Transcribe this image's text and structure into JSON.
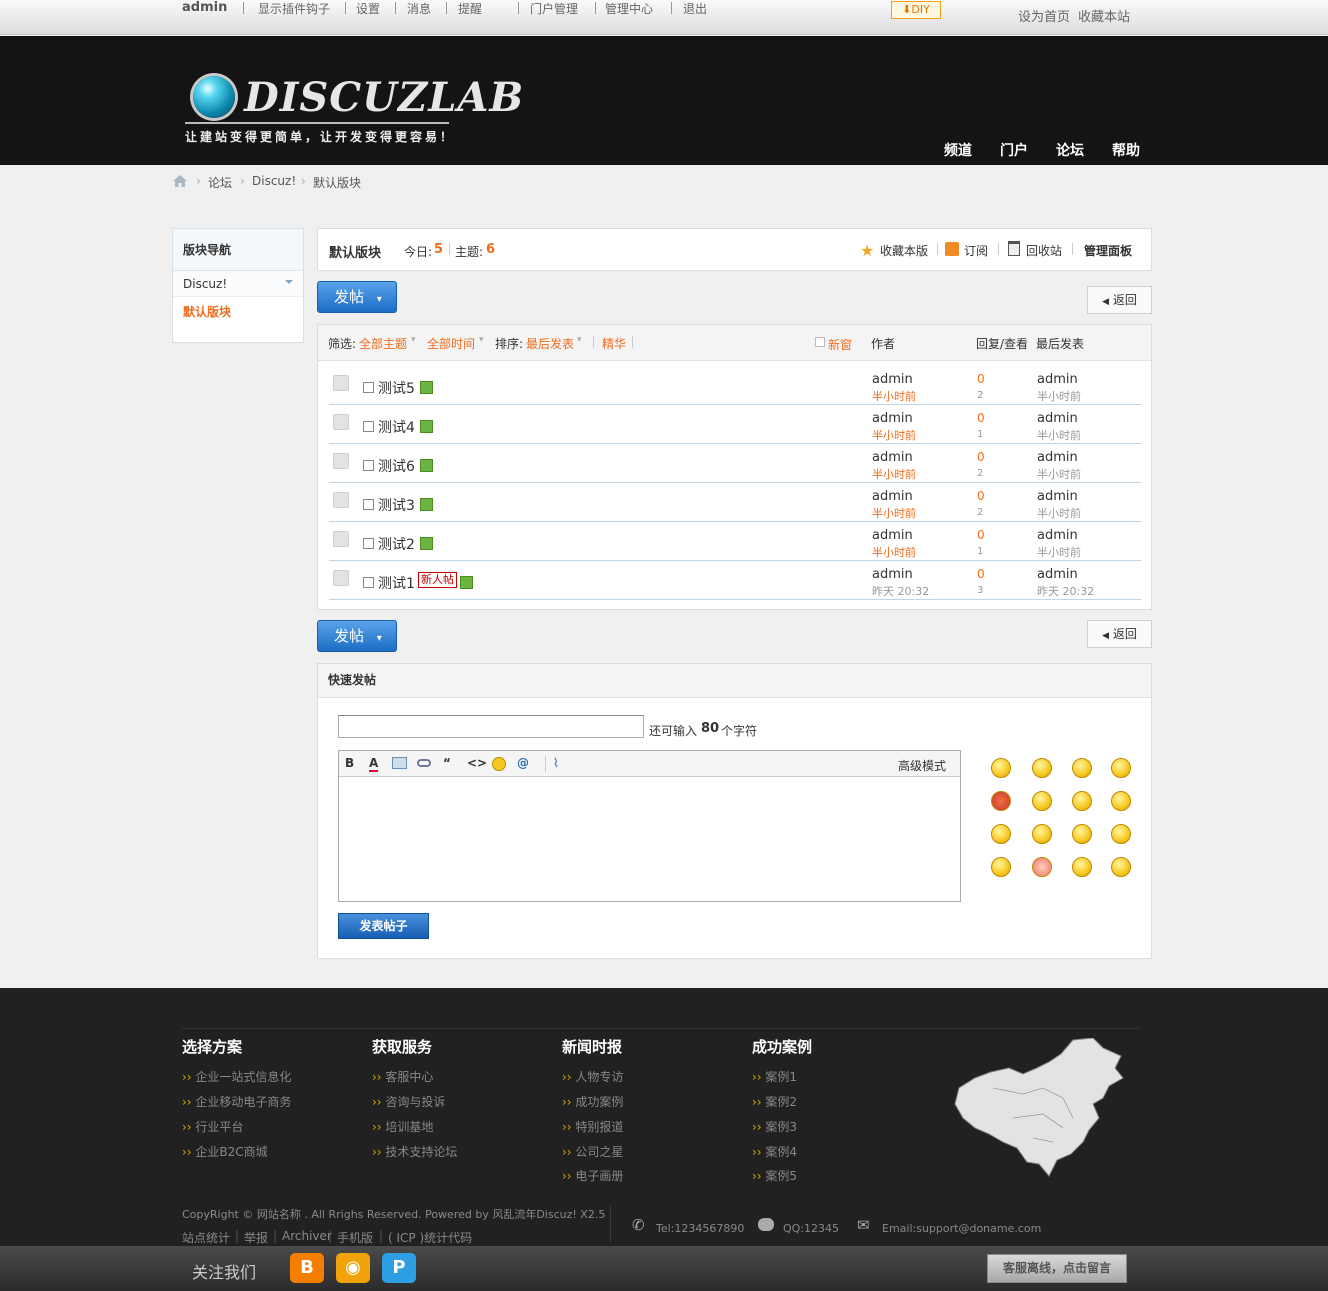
{
  "topbar": {
    "user": "admin",
    "links": [
      "显示插件钩子",
      "设置",
      "消息",
      "提醒",
      "门户管理",
      "管理中心",
      "退出"
    ],
    "diy": "DIY",
    "set_home": "设为首页",
    "favorite": "收藏本站"
  },
  "header": {
    "logo_text": "DISCUZLAB",
    "slogan": "让建站变得更简单，让开发变得更容易！",
    "nav": [
      "频道",
      "门户",
      "论坛",
      "帮助"
    ]
  },
  "breadcrumb": [
    "论坛",
    "Discuz!",
    "默认版块"
  ],
  "sidebar": {
    "title": "版块导航",
    "items": [
      "Discuz!",
      "默认版块"
    ]
  },
  "forum": {
    "name": "默认版块",
    "today_label": "今日:",
    "today": "5",
    "threads_label": "主题:",
    "threads": "6",
    "actions": [
      "收藏本版",
      "订阅",
      "回收站",
      "管理面板"
    ],
    "post_button": "发帖",
    "back_button": "返回"
  },
  "thread_list": {
    "filter_label": "筛选:",
    "filter_all": "全部主题",
    "filter_time": "全部时间",
    "sort_label": "排序:",
    "sort_value": "最后发表",
    "digest": "精华",
    "new_window": "新窗",
    "col_author": "作者",
    "col_replies": "回复/查看",
    "col_last": "最后发表",
    "rows": [
      {
        "title": "测试5",
        "badge": "",
        "author": "admin",
        "time": "半小时前",
        "replies": "0",
        "views": "2",
        "last_user": "admin",
        "last_time": "半小时前"
      },
      {
        "title": "测试4",
        "badge": "",
        "author": "admin",
        "time": "半小时前",
        "replies": "0",
        "views": "1",
        "last_user": "admin",
        "last_time": "半小时前"
      },
      {
        "title": "测试6",
        "badge": "",
        "author": "admin",
        "time": "半小时前",
        "replies": "0",
        "views": "2",
        "last_user": "admin",
        "last_time": "半小时前"
      },
      {
        "title": "测试3",
        "badge": "",
        "author": "admin",
        "time": "半小时前",
        "replies": "0",
        "views": "2",
        "last_user": "admin",
        "last_time": "半小时前"
      },
      {
        "title": "测试2",
        "badge": "",
        "author": "admin",
        "time": "半小时前",
        "replies": "0",
        "views": "1",
        "last_user": "admin",
        "last_time": "半小时前"
      },
      {
        "title": "测试1",
        "badge": "新人帖",
        "author": "admin",
        "time": "昨天 20:32",
        "replies": "0",
        "views": "3",
        "last_user": "admin",
        "last_time": "昨天 20:32"
      }
    ]
  },
  "quick_post": {
    "title": "快速发帖",
    "remaining_prefix": "还可输入",
    "remaining": "80",
    "remaining_suffix": "个字符",
    "advanced": "高级模式",
    "submit": "发表帖子"
  },
  "footer": {
    "columns": [
      {
        "title": "选择方案",
        "links": [
          "企业一站式信息化",
          "企业移动电子商务",
          "行业平台",
          "企业B2C商城"
        ]
      },
      {
        "title": "获取服务",
        "links": [
          "客服中心",
          "咨询与投诉",
          "培训基地",
          "技术支持论坛"
        ]
      },
      {
        "title": "新闻时报",
        "links": [
          "人物专访",
          "成功案例",
          "特别报道",
          "公司之星",
          "电子画册"
        ]
      },
      {
        "title": "成功案例",
        "links": [
          "案例1",
          "案例2",
          "案例3",
          "案例4",
          "案例5"
        ]
      }
    ],
    "copyright": "CopyRight © 网站名称 . All Rrighs Reserved. Powered by 风乱流年Discuz! X2.5",
    "bottom_links": [
      "站点统计",
      "举报",
      "Archiver",
      "手机版",
      "( ICP )统计代码"
    ],
    "tel": "Tel:1234567890",
    "qq": "QQ:12345",
    "email": "Email:support@doname.com",
    "follow": "关注我们",
    "service": "客服离线，点击留言"
  }
}
